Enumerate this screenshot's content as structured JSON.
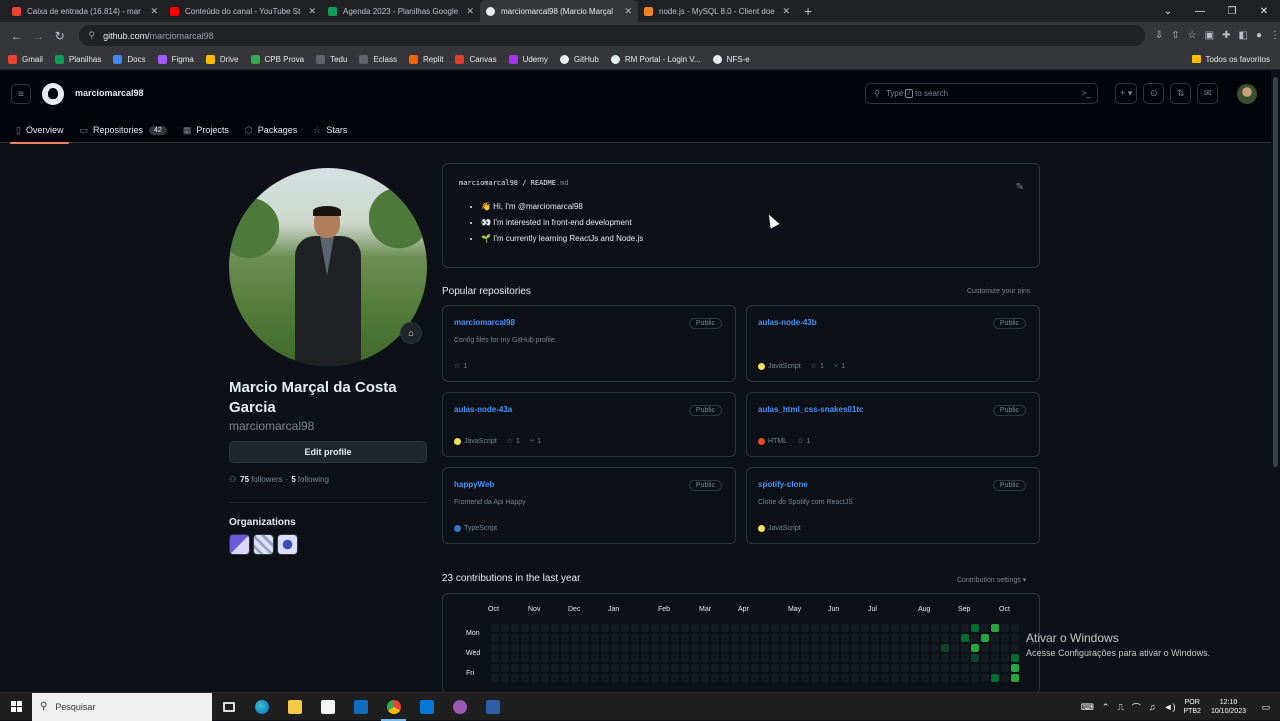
{
  "browser": {
    "tabs": [
      {
        "title": "Caixa de entrada (16.814) - mar",
        "color": "#ea4335"
      },
      {
        "title": "Conteúdo do canal - YouTube St",
        "color": "#ff0000"
      },
      {
        "title": "Agenda 2023 - Planilhas Google",
        "color": "#0f9d58"
      },
      {
        "title": "marciomarcal98 (Marcio Marçal",
        "color": "#e6edf3"
      },
      {
        "title": "node.js - MySQL 8.0 - Client doe",
        "color": "#f48024"
      }
    ],
    "new_tab": "+",
    "url_host": "github.com/",
    "url_path": "marciomarcal98",
    "bookmarks": [
      {
        "label": "Gmail",
        "color": "#ea4335"
      },
      {
        "label": "Planilhas",
        "color": "#0f9d58"
      },
      {
        "label": "Docs",
        "color": "#4285f4"
      },
      {
        "label": "Figma",
        "color": "#a259ff"
      },
      {
        "label": "Drive",
        "color": "#fbbc04"
      },
      {
        "label": "CPB Prova",
        "color": "#34a853"
      },
      {
        "label": "Tedu",
        "color": "#5f6368"
      },
      {
        "label": "Eclass",
        "color": "#5f6368"
      },
      {
        "label": "Replit",
        "color": "#f26207"
      },
      {
        "label": "Canvas",
        "color": "#e13f2b"
      },
      {
        "label": "Udemy",
        "color": "#a435f0"
      },
      {
        "label": "GitHub",
        "color": "#e6edf3"
      },
      {
        "label": "RM Portal - Login V...",
        "color": "#e6edf3"
      },
      {
        "label": "NFS-e",
        "color": "#e6edf3"
      }
    ],
    "all_favorites": "Todos os favoritos"
  },
  "github": {
    "username": "marciomarcal98",
    "search_prefix": "Type",
    "search_key": "/",
    "search_suffix": "to search",
    "nav": {
      "overview": "Overview",
      "repositories": "Repositories",
      "repo_count": "42",
      "projects": "Projects",
      "packages": "Packages",
      "stars": "Stars"
    },
    "profile": {
      "full_name": "Marcio Marçal da Costa Garcia",
      "login": "marciomarcal98",
      "edit_profile": "Edit profile",
      "followers_count": "75",
      "followers_label": "followers",
      "following_count": "5",
      "following_label": "following",
      "organizations_title": "Organizations"
    },
    "readme": {
      "path_user": "marciomarcal98",
      "path_sep": " / ",
      "path_file": "README",
      "path_ext": ".md",
      "lines": [
        "👋 Hi, I'm @marciomarcal98",
        "👀 I'm interested in front-end development",
        "🌱 I'm currently learning ReactJs and Node.js"
      ]
    },
    "popular": {
      "title": "Popular repositories",
      "customize": "Customize your pins",
      "repos": [
        {
          "name": "marciomarcal98",
          "badge": "Public",
          "desc": "Config files for my GitHub profile.",
          "lang": "",
          "lang_color": "",
          "stars": "1",
          "forks": ""
        },
        {
          "name": "aulas-node-43b",
          "badge": "Public",
          "desc": "",
          "lang": "JavaScript",
          "lang_color": "#f1e05a",
          "stars": "1",
          "forks": "1"
        },
        {
          "name": "aulas-node-43a",
          "badge": "Public",
          "desc": "",
          "lang": "JavaScript",
          "lang_color": "#f1e05a",
          "stars": "1",
          "forks": "1"
        },
        {
          "name": "aulas_html_css-snakes01tc",
          "badge": "Public",
          "desc": "",
          "lang": "HTML",
          "lang_color": "#e34c26",
          "stars": "1",
          "forks": ""
        },
        {
          "name": "happyWeb",
          "badge": "Public",
          "desc": "Frontend da Api Happy",
          "lang": "TypeScript",
          "lang_color": "#3178c6",
          "stars": "",
          "forks": ""
        },
        {
          "name": "spotify-clone",
          "badge": "Public",
          "desc": "Clone do Spotify com ReactJS",
          "lang": "JavaScript",
          "lang_color": "#f1e05a",
          "stars": "",
          "forks": ""
        }
      ]
    },
    "contributions": {
      "title": "23 contributions in the last year",
      "settings": "Contribution settings ▾",
      "months": [
        "Oct",
        "Nov",
        "Dec",
        "Jan",
        "Feb",
        "Mar",
        "Apr",
        "May",
        "Jun",
        "Jul",
        "Aug",
        "Sep",
        "Oct"
      ],
      "days": [
        "Mon",
        "Wed",
        "Fri"
      ]
    }
  },
  "watermark": {
    "line1": "Ativar o Windows",
    "line2": "Acesse Configurações para ativar o Windows."
  },
  "taskbar": {
    "search": "Pesquisar",
    "lang1": "POR",
    "lang2": "PTB2",
    "time": "12:10",
    "date": "10/10/2023"
  }
}
